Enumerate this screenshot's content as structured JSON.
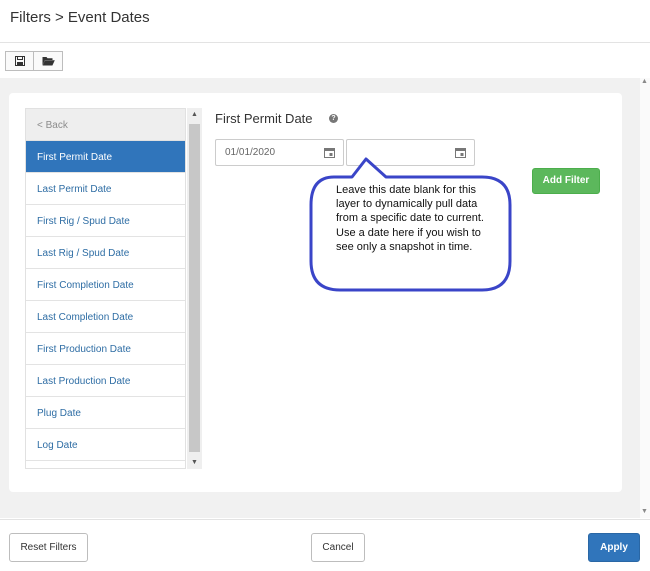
{
  "header": {
    "title": "Filters > Event Dates"
  },
  "toolbar": {
    "save_icon": "save-icon",
    "open_icon": "folder-open-icon"
  },
  "sidebar": {
    "back_label": "< Back",
    "items": [
      {
        "label": "First Permit Date",
        "active": true
      },
      {
        "label": "Last Permit Date",
        "active": false
      },
      {
        "label": "First Rig / Spud Date",
        "active": false
      },
      {
        "label": "Last Rig / Spud Date",
        "active": false
      },
      {
        "label": "First Completion Date",
        "active": false
      },
      {
        "label": "Last Completion Date",
        "active": false
      },
      {
        "label": "First Production Date",
        "active": false
      },
      {
        "label": "Last Production Date",
        "active": false
      },
      {
        "label": "Plug Date",
        "active": false
      },
      {
        "label": "Log Date",
        "active": false
      }
    ]
  },
  "main": {
    "field_title": "First Permit Date",
    "help_symbol": "?",
    "date_from": {
      "value": "01/01/2020"
    },
    "date_to": {
      "value": ""
    },
    "add_filter_label": "Add Filter",
    "callout_text": "Leave this date blank for this layer to dynamically pull data from a specific date to current. Use a date here if you wish to see only a snapshot in time."
  },
  "footer": {
    "reset_label": "Reset Filters",
    "cancel_label": "Cancel",
    "apply_label": "Apply"
  },
  "colors": {
    "active_nav": "#3075bb",
    "link": "#2e6da4",
    "add_filter": "#5cb85c",
    "apply": "#3075bb",
    "callout_border": "#3a45c8"
  }
}
